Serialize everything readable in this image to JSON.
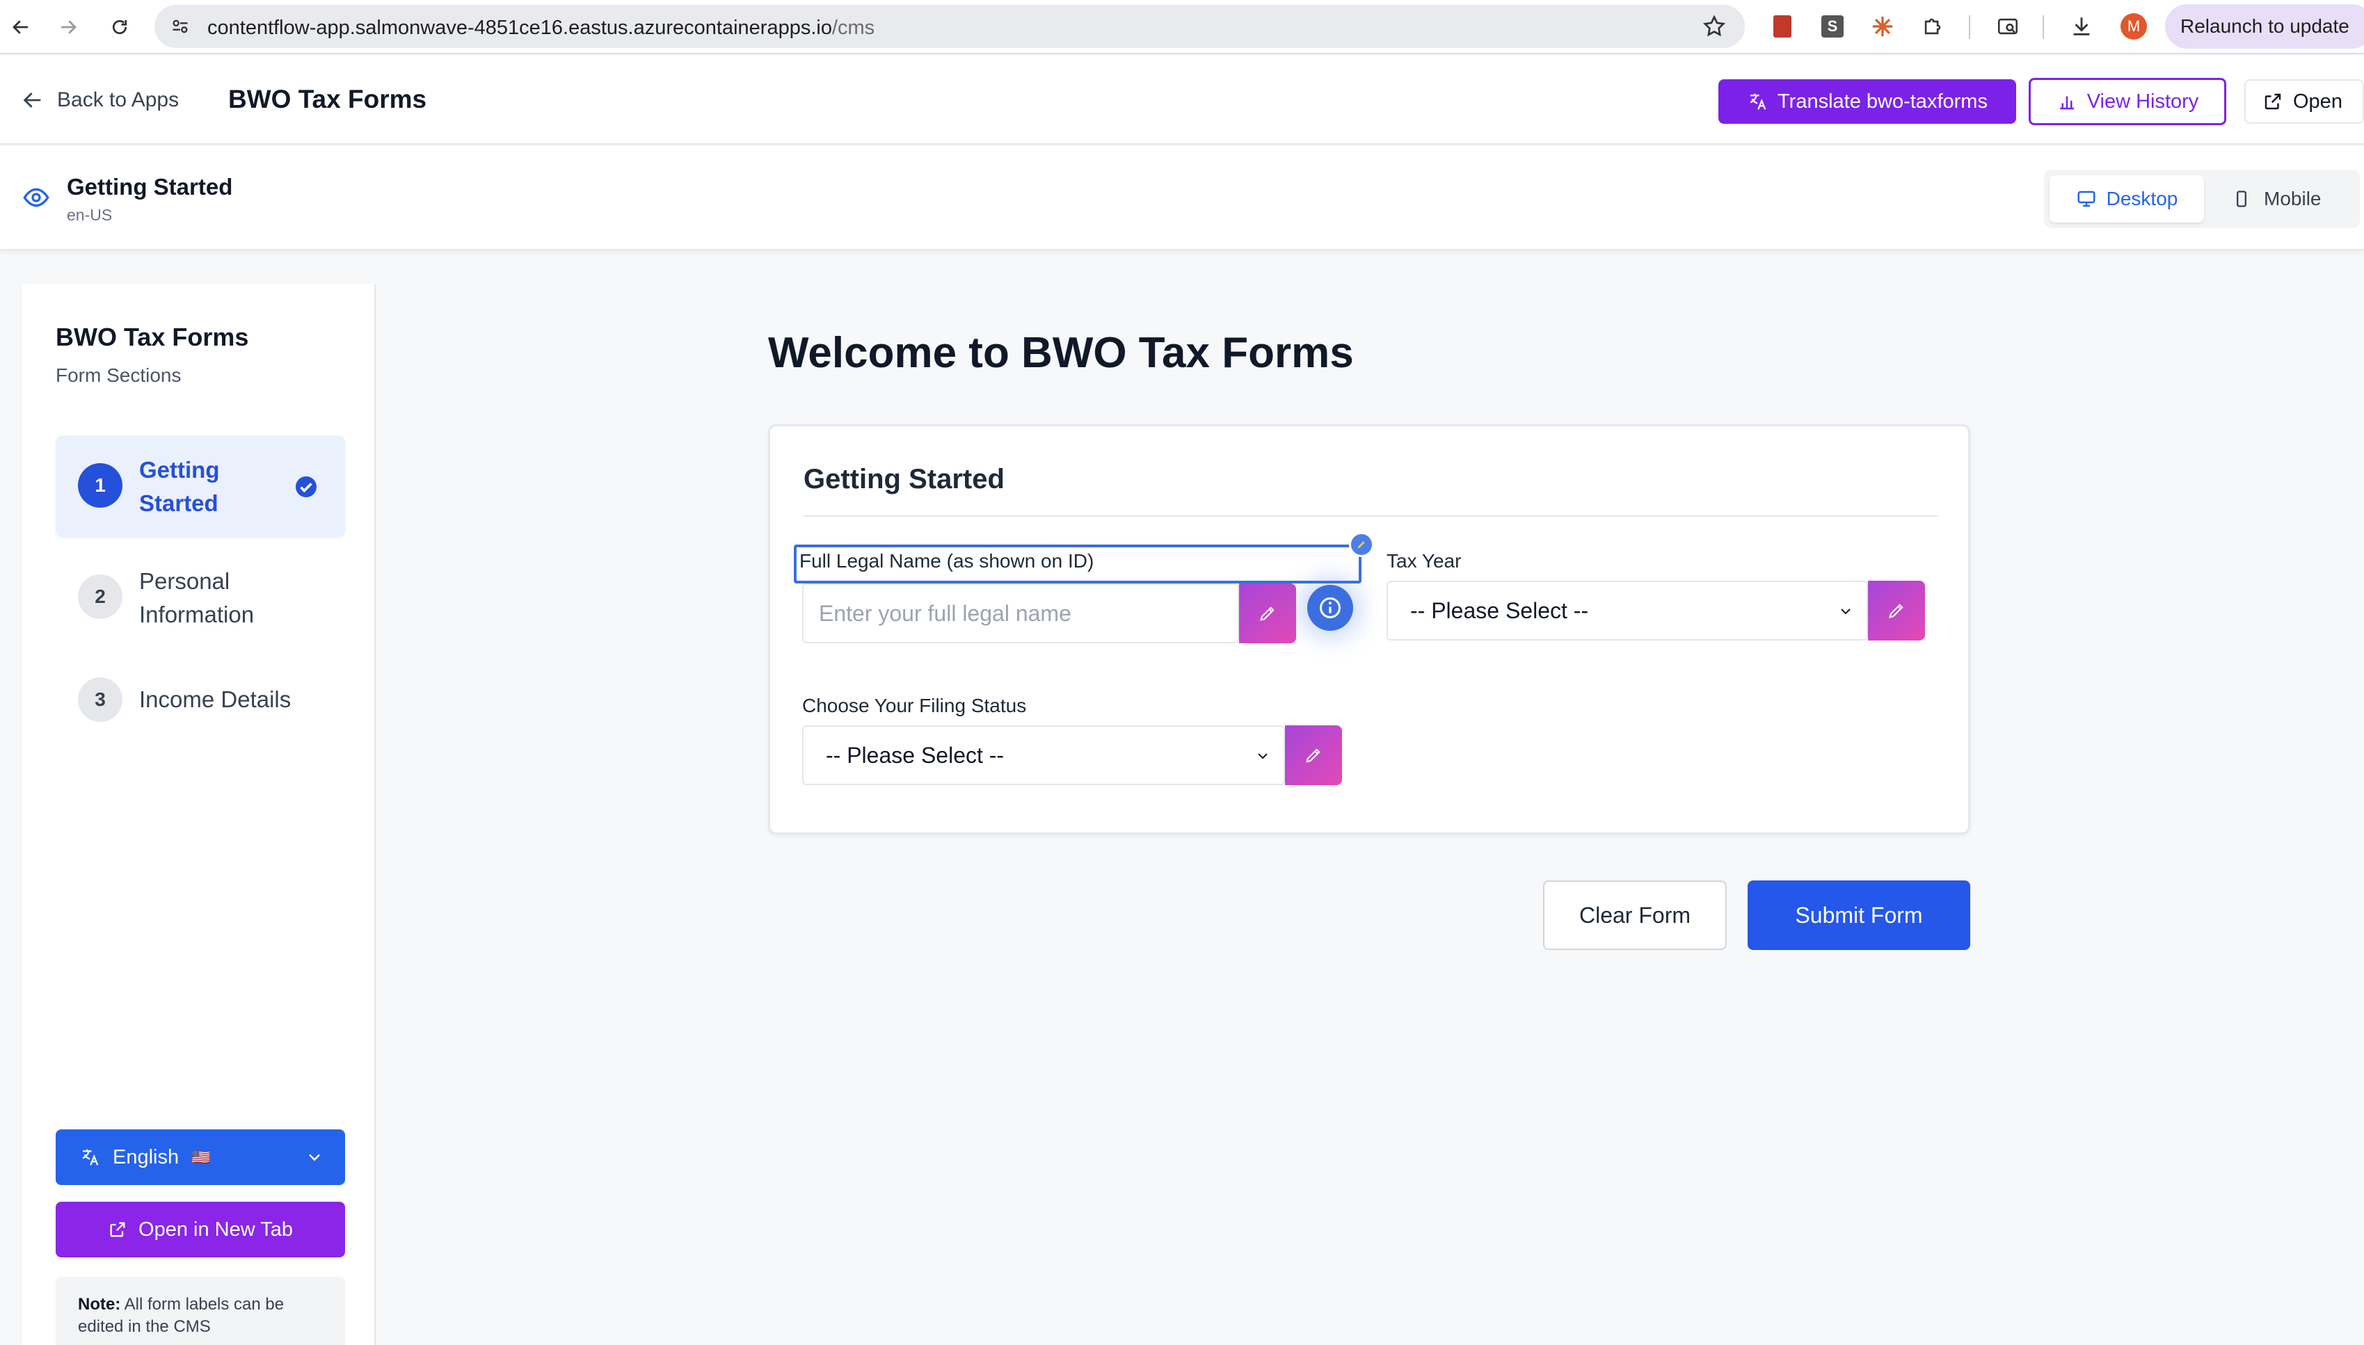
{
  "browser": {
    "url_host": "contentflow-app.salmonwave-4851ce16.eastus.azurecontainerapps.io",
    "url_path": "/cms",
    "avatar_initial": "M",
    "relaunch_label": "Relaunch to update"
  },
  "header": {
    "back_label": "Back to Apps",
    "app_title": "BWO Tax Forms",
    "translate_label": "Translate bwo-taxforms",
    "history_label": "View History",
    "open_label": "Open"
  },
  "preview": {
    "page_title": "Getting Started",
    "locale": "en-US",
    "desktop_label": "Desktop",
    "mobile_label": "Mobile"
  },
  "sidebar": {
    "title": "BWO Tax Forms",
    "subtitle": "Form Sections",
    "steps": [
      {
        "number": "1",
        "label": "Getting Started",
        "state": "active-complete"
      },
      {
        "number": "2",
        "label": "Personal Information",
        "state": "inactive"
      },
      {
        "number": "3",
        "label": "Income Details",
        "state": "inactive"
      }
    ],
    "language_label": "English",
    "language_flag": "🇺🇸",
    "new_tab_label": "Open in New Tab",
    "note_bold": "Note:",
    "note_text": " All form labels can be edited in the CMS"
  },
  "main": {
    "title": "Welcome to BWO Tax Forms",
    "card_title": "Getting Started",
    "fields": {
      "full_name": {
        "label": "Full Legal Name (as shown on ID)",
        "placeholder": "Enter your full legal name",
        "value": ""
      },
      "tax_year": {
        "label": "Tax Year",
        "value": "-- Please Select --"
      },
      "filing_status": {
        "label": "Choose Your Filing Status",
        "value": "-- Please Select --"
      }
    },
    "clear_label": "Clear Form",
    "submit_label": "Submit Form"
  },
  "colors": {
    "primary_blue": "#2563eb",
    "purple": "#7c22e8",
    "edit_gradient_start": "#a646d8",
    "edit_gradient_end": "#e349b8"
  }
}
